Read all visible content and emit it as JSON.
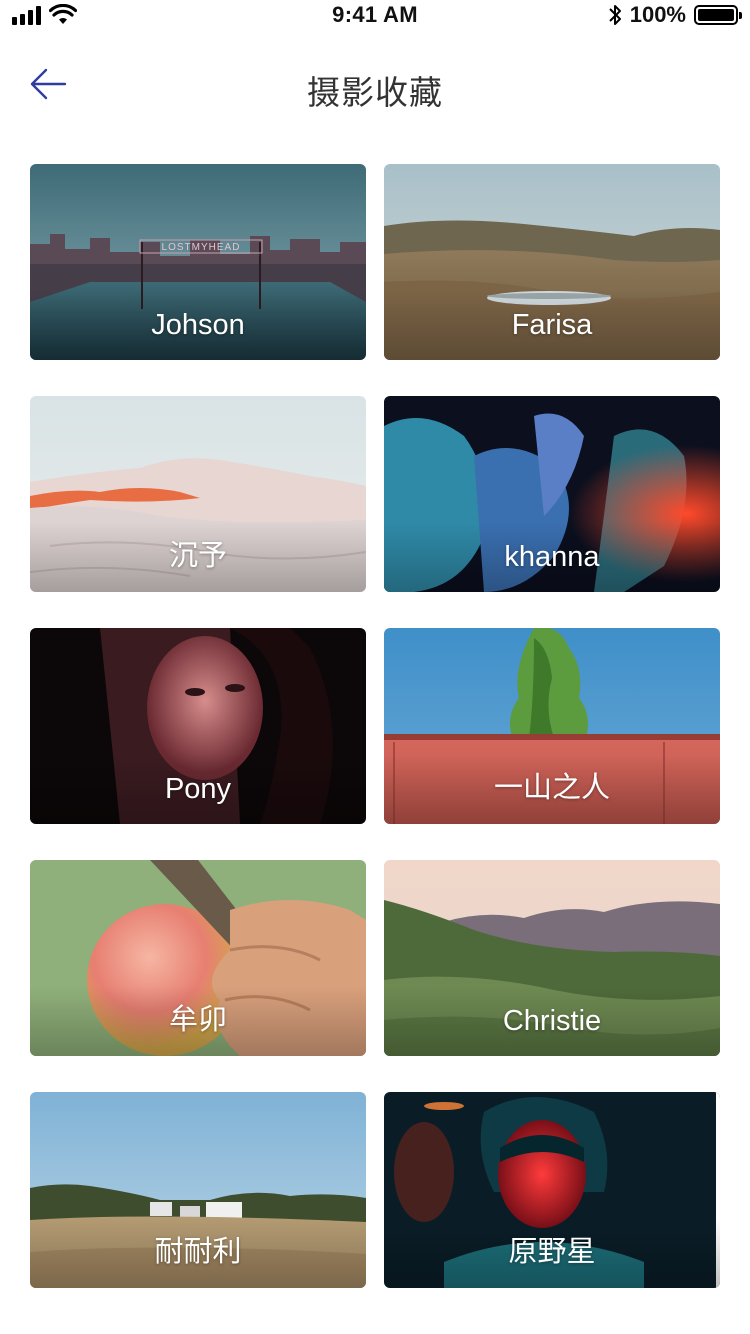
{
  "status_bar": {
    "time": "9:41 AM",
    "battery_text": "100%",
    "icons": [
      "signal-icon",
      "wifi-icon",
      "bluetooth-icon",
      "battery-icon"
    ]
  },
  "header": {
    "title": "摄影收藏",
    "back_icon": "arrow-left-icon"
  },
  "colors": {
    "accent": "#2f3da0",
    "title": "#333333"
  },
  "albums": [
    {
      "label": "Johson"
    },
    {
      "label": "Farisa"
    },
    {
      "label": "沉予"
    },
    {
      "label": "khanna"
    },
    {
      "label": "Pony"
    },
    {
      "label": "一山之人"
    },
    {
      "label": "牟卯"
    },
    {
      "label": "Christie"
    },
    {
      "label": "耐耐利"
    },
    {
      "label": "原野星"
    }
  ],
  "photo_text": {
    "sign_text": "LOSTMYHEAD"
  }
}
